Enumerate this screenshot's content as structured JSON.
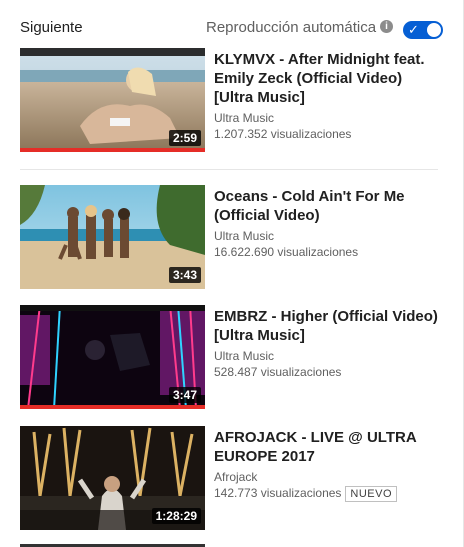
{
  "header": {
    "title": "Siguiente",
    "autoplay_label": "Reproducción automática",
    "info_icon": "info-icon",
    "toggle_state": "on",
    "toggle_color": "#065fd4"
  },
  "videos": [
    {
      "title": "KLYMVX - After Midnight feat. Emily Zeck (Official Video) [Ultra Music]",
      "channel": "Ultra Music",
      "views": "1.207.352 visualizaciones",
      "duration": "2:59",
      "watched_fraction": 1.0
    },
    {
      "title": "Oceans - Cold Ain't For Me (Official Video)",
      "channel": "Ultra Music",
      "views": "16.622.690 visualizaciones",
      "duration": "3:43",
      "watched_fraction": 0
    },
    {
      "title": "EMBRZ - Higher (Official Video) [Ultra Music]",
      "channel": "Ultra Music",
      "views": "528.487 visualizaciones",
      "duration": "3:47",
      "watched_fraction": 1.0
    },
    {
      "title": "AFROJACK - LIVE @ ULTRA EUROPE 2017",
      "channel": "Afrojack",
      "views": "142.773 visualizaciones",
      "badge": "NUEVO",
      "duration": "1:28:29",
      "watched_fraction": 0
    }
  ],
  "colors": {
    "progress": "#e52d27",
    "accent": "#065fd4"
  }
}
